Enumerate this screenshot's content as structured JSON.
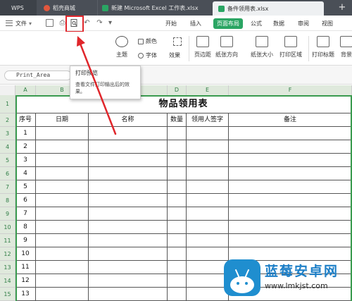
{
  "tabs": {
    "wps": "WPS",
    "store": "稻壳商城",
    "new_file": "新建 Microsoft Excel 工作表.xlsx",
    "active_file": "备件领用表.xlsx",
    "close": "×",
    "plus": "+"
  },
  "menu": {
    "file": "文件",
    "ribbon_tabs": [
      "开始",
      "插入",
      "页面布局",
      "公式",
      "数据",
      "审阅",
      "视图"
    ],
    "active_tab": "页面布局"
  },
  "ribbon": {
    "theme": "主题",
    "color": "颜色",
    "font": "字体",
    "effect": "效果",
    "margin": "页边距",
    "orientation": "纸张方向",
    "size": "纸张大小",
    "print_area": "打印区域",
    "print_titles": "打印标题",
    "background": "背景"
  },
  "formula_bar": {
    "name_box": "Print_Area"
  },
  "tooltip": {
    "title": "打印预览",
    "desc": "查看文件打印输出后的效果。"
  },
  "sheet": {
    "columns": [
      "A",
      "B",
      "C",
      "D",
      "E",
      "F"
    ],
    "title": "物品领用表",
    "headers": [
      "序号",
      "日期",
      "名称",
      "数量",
      "领用人签字",
      "备注"
    ],
    "rows": [
      "1",
      "2",
      "3",
      "4",
      "5",
      "6",
      "7",
      "8",
      "9",
      "10",
      "11",
      "12",
      "13"
    ],
    "row_numbers": [
      "1",
      "2",
      "3",
      "4",
      "5",
      "6",
      "7",
      "8",
      "9",
      "10",
      "11",
      "12",
      "13",
      "14",
      "15"
    ]
  },
  "watermark": {
    "title": "蓝莓安卓网",
    "url": "www.lmkjst.com"
  },
  "colors": {
    "accent_green": "#2aa563",
    "highlight_red": "#e0262b",
    "tabbar": "#4a4f57"
  },
  "icons": [
    "menu-icon",
    "save-icon",
    "print-icon",
    "print-preview-icon",
    "undo-icon",
    "redo-icon",
    "theme-icon",
    "color-icon",
    "font-icon",
    "effect-icon",
    "margin-icon",
    "orientation-icon",
    "paper-size-icon",
    "print-area-icon",
    "print-titles-icon",
    "background-icon"
  ]
}
